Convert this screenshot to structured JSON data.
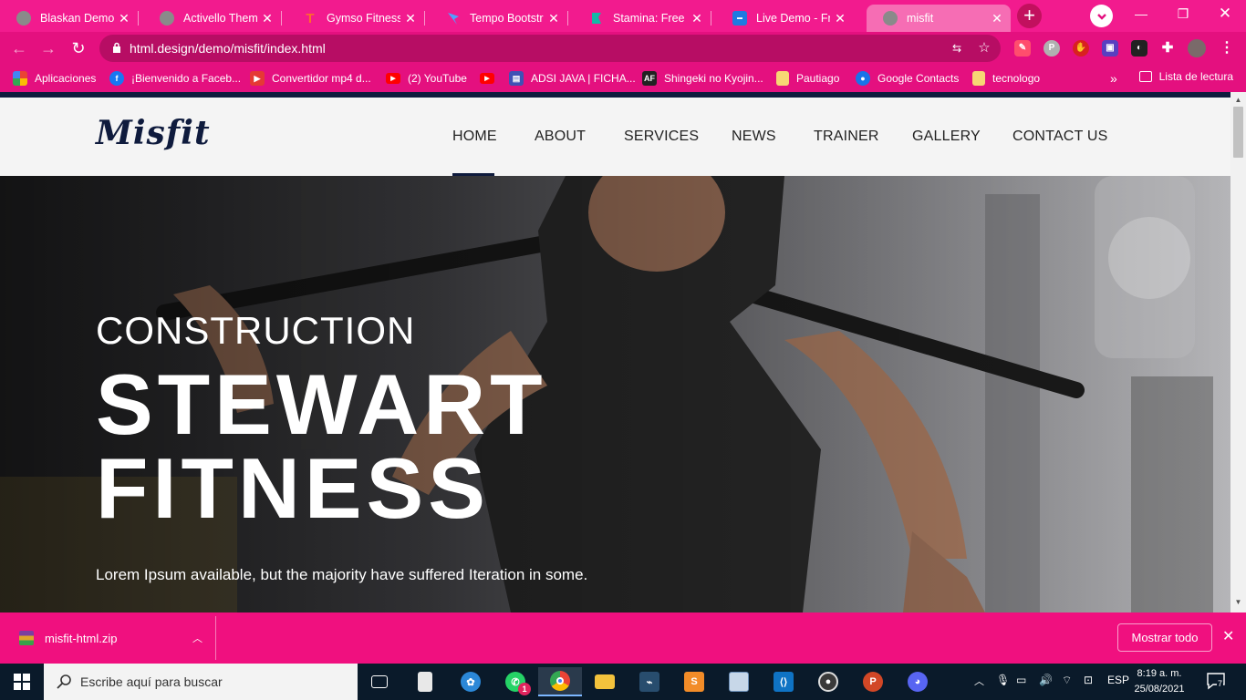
{
  "browser": {
    "tabs": [
      {
        "title": "Blaskan Demo - Ju",
        "icon": "globe-icon",
        "color": "#3c4043"
      },
      {
        "title": "Activello Theme D",
        "icon": "globe-icon",
        "color": "#3c4043"
      },
      {
        "title": "Gymso Fitness - L",
        "icon": "letter-t-icon",
        "color": "#ff6a2c"
      },
      {
        "title": "Tempo Bootstrap",
        "icon": "tempo-icon",
        "color": "#3b82f6"
      },
      {
        "title": "Stamina: Free HTM",
        "icon": "stamina-icon",
        "color": "#12b8a6"
      },
      {
        "title": "Live Demo - Free",
        "icon": "mockup-icon",
        "color": "#1f7ae0"
      },
      {
        "title": "misfit",
        "icon": "globe-icon",
        "color": "#5f6368",
        "active": true
      }
    ],
    "url": "html.design/demo/misfit/index.html",
    "bookmarks": [
      {
        "label": "Aplicaciones",
        "icon": "apps-grid-icon",
        "color": "#fbbc04"
      },
      {
        "label": "¡Bienvenido a Faceb...",
        "icon": "facebook-icon",
        "color": "#1877f2"
      },
      {
        "label": "Convertidor mp4 d...",
        "icon": "play-icon",
        "color": "#e53935"
      },
      {
        "label": "(2) YouTube",
        "icon": "youtube-icon",
        "color": "#ff0000"
      },
      {
        "label": "",
        "icon": "youtube-icon",
        "color": "#ff0000"
      },
      {
        "label": "ADSI JAVA | FICHA...",
        "icon": "form-icon",
        "color": "#3f51b5"
      },
      {
        "label": "Shingeki no Kyojin...",
        "icon": "af-icon",
        "color": "#222222"
      },
      {
        "label": "Pautiago",
        "icon": "folder-icon",
        "color": "#f7d774"
      },
      {
        "label": "Google Contacts",
        "icon": "contacts-icon",
        "color": "#1a73e8"
      },
      {
        "label": "tecnologo",
        "icon": "folder-icon",
        "color": "#f7d774"
      }
    ],
    "reading_list": "Lista de lectura",
    "more_bookmarks": "»"
  },
  "site": {
    "logo": "Misfit",
    "menu": [
      "HOME",
      "ABOUT",
      "SERVICES",
      "NEWS",
      "TRAINER",
      "GALLERY",
      "CONTACT US"
    ],
    "active_menu": "HOME",
    "hero": {
      "subtitle": "CONSTRUCTION",
      "title_line1": "STEWART",
      "title_line2": "FITNESS",
      "text": "Lorem Ipsum available, but the majority have suffered Iteration in some."
    }
  },
  "downloads": {
    "file": "misfit-html.zip",
    "show_all": "Mostrar todo"
  },
  "taskbar": {
    "search_placeholder": "Escribe aquí para buscar",
    "whatsapp_badge": "1",
    "language": "ESP",
    "time": "8:19 a. m.",
    "date": "25/08/2021",
    "notifications": "7"
  },
  "colors": {
    "browser_pink": "#f21b8e",
    "site_navy": "#0f1b3d"
  }
}
